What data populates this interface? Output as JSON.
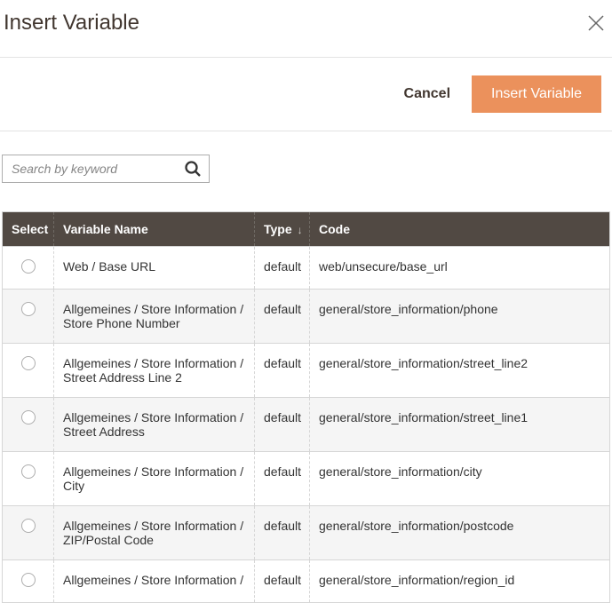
{
  "header": {
    "title": "Insert Variable"
  },
  "actions": {
    "cancel_label": "Cancel",
    "insert_label": "Insert Variable"
  },
  "search": {
    "placeholder": "Search by keyword"
  },
  "columns": {
    "select": "Select",
    "name": "Variable Name",
    "type": "Type",
    "sort_indicator": "↓",
    "code": "Code"
  },
  "rows": [
    {
      "name": "Web / Base URL",
      "type": "default",
      "code": "web/unsecure/base_url"
    },
    {
      "name": "Allgemeines / Store Information / Store Phone Number",
      "type": "default",
      "code": "general/store_information/phone"
    },
    {
      "name": "Allgemeines / Store Information / Street Address Line 2",
      "type": "default",
      "code": "general/store_information/street_line2"
    },
    {
      "name": "Allgemeines / Store Information / Street Address",
      "type": "default",
      "code": "general/store_information/street_line1"
    },
    {
      "name": "Allgemeines / Store Information / City",
      "type": "default",
      "code": "general/store_information/city"
    },
    {
      "name": "Allgemeines / Store Information / ZIP/Postal Code",
      "type": "default",
      "code": "general/store_information/postcode"
    },
    {
      "name": "Allgemeines / Store Information /",
      "type": "default",
      "code": "general/store_information/region_id"
    }
  ]
}
